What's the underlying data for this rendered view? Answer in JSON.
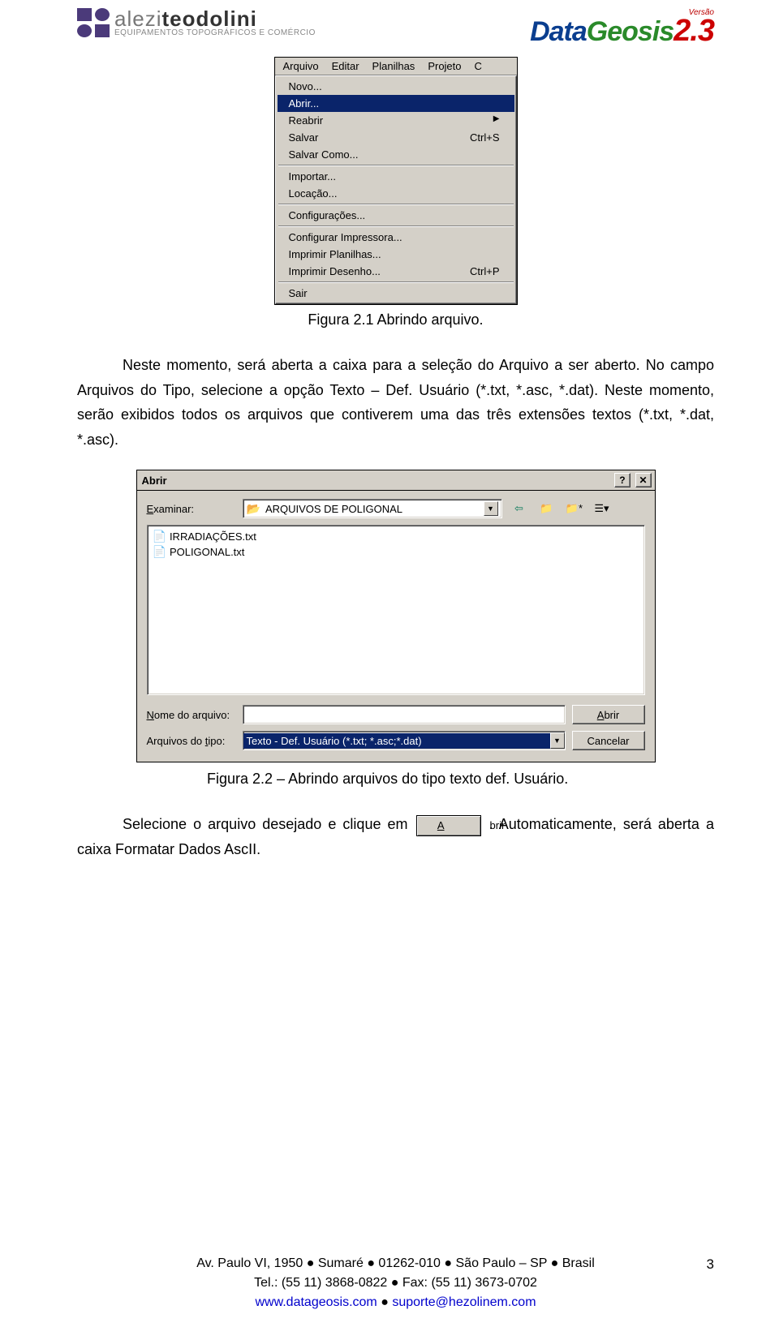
{
  "header": {
    "logo_left_brand_light": "alezi",
    "logo_left_brand_bold": "teodolini",
    "logo_left_tagline": "EQUIPAMENTOS TOPOGRÁFICOS E COMÉRCIO",
    "logo_right_versao": "Versão",
    "logo_right_data": "Data",
    "logo_right_geosis": "Geosis",
    "logo_right_ver": "2.3"
  },
  "fig1": {
    "menubar": [
      "Arquivo",
      "Editar",
      "Planilhas",
      "Projeto",
      "C"
    ],
    "menu_items": [
      {
        "label": "Novo...",
        "shortcut": "",
        "type": "item"
      },
      {
        "label": "Abrir...",
        "shortcut": "",
        "type": "sel"
      },
      {
        "label": "Reabrir",
        "shortcut": "▶",
        "type": "item-sub"
      },
      {
        "label": "Salvar",
        "shortcut": "Ctrl+S",
        "type": "item"
      },
      {
        "label": "Salvar Como...",
        "shortcut": "",
        "type": "item"
      },
      {
        "type": "sep"
      },
      {
        "label": "Importar...",
        "shortcut": "",
        "type": "item"
      },
      {
        "label": "Locação...",
        "shortcut": "",
        "type": "item"
      },
      {
        "type": "sep"
      },
      {
        "label": "Configurações...",
        "shortcut": "",
        "type": "item"
      },
      {
        "type": "sep"
      },
      {
        "label": "Configurar Impressora...",
        "shortcut": "",
        "type": "item"
      },
      {
        "label": "Imprimir Planilhas...",
        "shortcut": "",
        "type": "item"
      },
      {
        "label": "Imprimir Desenho...",
        "shortcut": "Ctrl+P",
        "type": "item"
      },
      {
        "type": "sep"
      },
      {
        "label": "Sair",
        "shortcut": "",
        "type": "item"
      }
    ],
    "caption": "Figura 2.1 Abrindo arquivo."
  },
  "paragraph1": "Neste momento, será aberta a caixa para a seleção do Arquivo a ser aberto. No campo Arquivos do Tipo, selecione a opção Texto – Def. Usuário (*.txt, *.asc, *.dat). Neste momento, serão exibidos todos os arquivos que contiverem uma das três extensões textos (*.txt, *.dat, *.asc).",
  "fig2": {
    "title": "Abrir",
    "examinar_label": "Examinar:",
    "examinar_value": "ARQUIVOS DE POLIGONAL",
    "files": [
      "IRRADIAÇÕES.txt",
      "POLIGONAL.txt"
    ],
    "nome_label_pre": "N",
    "nome_label_post": "ome do arquivo:",
    "tipo_label_pre": "Arquivos do ",
    "tipo_label_under": "t",
    "tipo_label_post": "ipo:",
    "tipo_value": "Texto - Def. Usuário (*.txt; *.asc;*.dat)",
    "btn_abrir_pre": "A",
    "btn_abrir_post": "brir",
    "btn_cancelar": "Cancelar",
    "caption": "Figura 2.2 – Abrindo arquivos do tipo texto def. Usuário."
  },
  "paragraph2_pre": "Selecione o arquivo desejado e clique em ",
  "paragraph2_btn_pre": "A",
  "paragraph2_btn_post": "brir",
  "paragraph2_post": ". Automaticamente, será aberta a caixa Formatar Dados AscII.",
  "footer": {
    "line1_a": "Av. Paulo VI, 1950 ",
    "line1_b": " Sumaré ",
    "line1_c": " 01262-010 ",
    "line1_d": " São Paulo – SP ",
    "line1_e": " Brasil",
    "line2_a": "Tel.: (55 11) 3868-0822 ",
    "line2_b": " Fax: (55 11) 3673-0702",
    "line3_a": "www.datageosis.com",
    "line3_b": " suporte@hezolinem.com",
    "page_num": "3"
  }
}
